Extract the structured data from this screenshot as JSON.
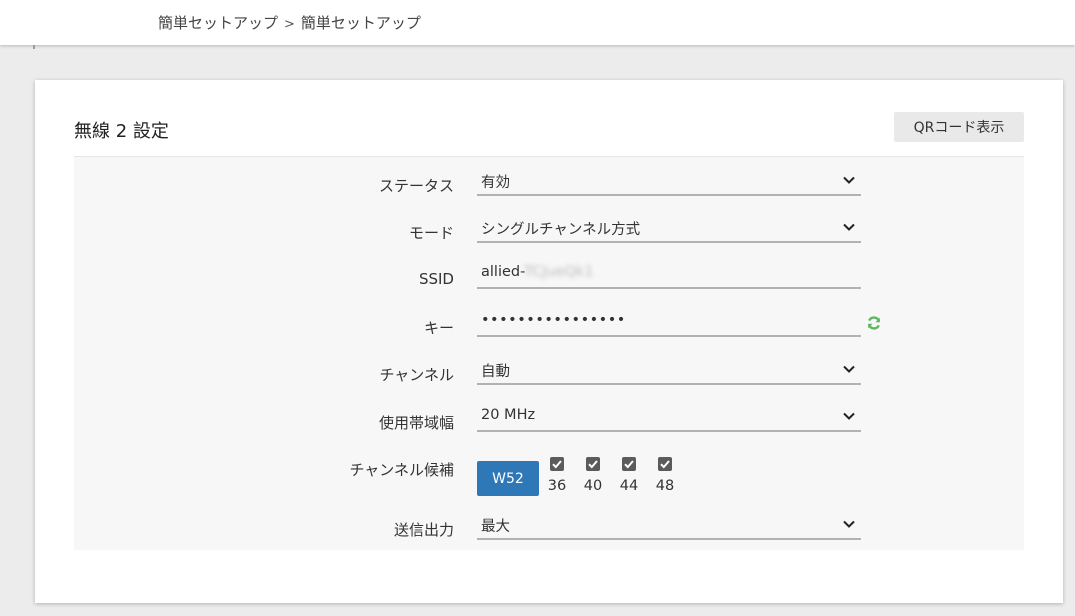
{
  "breadcrumb": {
    "items": [
      "簡単セットアップ",
      "簡単セットアップ"
    ],
    "separator": ">"
  },
  "card": {
    "title": "無線 2 設定",
    "qr_button_label": "QRコード表示"
  },
  "form": {
    "status": {
      "label": "ステータス",
      "value": "有効"
    },
    "mode": {
      "label": "モード",
      "value": "シングルチャンネル方式"
    },
    "ssid": {
      "label": "SSID",
      "value_visible": "allied-",
      "value_blurred": "TCJueQk1"
    },
    "key": {
      "label": "キー",
      "value": "••••••••••••••••"
    },
    "channel": {
      "label": "チャンネル",
      "value": "自動"
    },
    "bandwidth": {
      "label": "使用帯域幅",
      "value": "20 MHz"
    },
    "channel_candidates": {
      "label": "チャンネル候補",
      "group_button": "W52",
      "channels": [
        {
          "number": "36",
          "checked": true
        },
        {
          "number": "40",
          "checked": true
        },
        {
          "number": "44",
          "checked": true
        },
        {
          "number": "48",
          "checked": true
        }
      ]
    },
    "tx_power": {
      "label": "送信出力",
      "value": "最大"
    }
  },
  "icons": {
    "select_arrow": "chevron-down-icon",
    "key_regenerate": "refresh-icon",
    "checkbox": "checkbox-checked-icon"
  },
  "colors": {
    "accent_button": "#2f78b8",
    "refresh_icon": "#5cb85c",
    "checkbox_fill": "#5b5b5b"
  }
}
